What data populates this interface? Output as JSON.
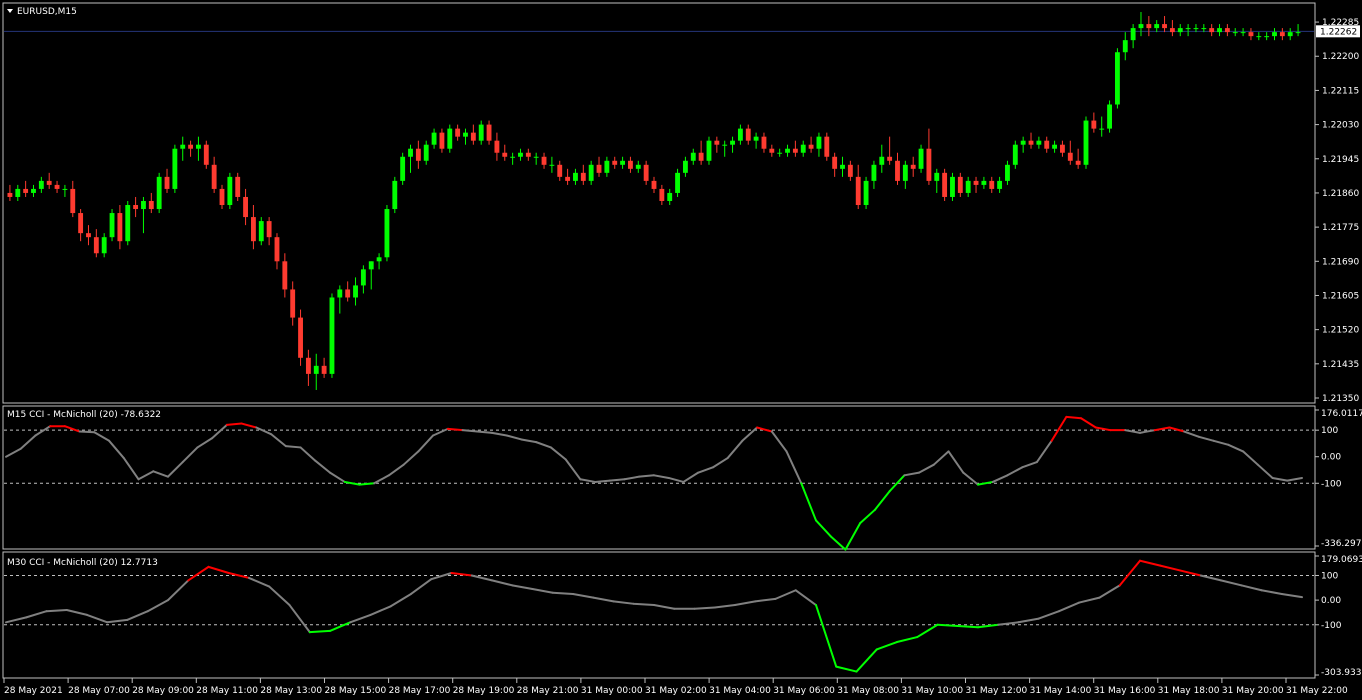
{
  "main_panel": {
    "title": "EURUSD,M15",
    "price_axis": [
      "1.22285",
      "1.22200",
      "1.22115",
      "1.22030",
      "1.21945",
      "1.21860",
      "1.21775",
      "1.21690",
      "1.21605",
      "1.21520",
      "1.21435",
      "1.21350"
    ],
    "current_price": "1.22262",
    "colors": {
      "bull": "#00ff00",
      "bear": "#ff3b30",
      "grid_line": "#24347a"
    }
  },
  "cci_m15": {
    "title": "M15 CCI - McNicholl (20) -78.6322",
    "axis": [
      "176.0117",
      "100",
      "0.00",
      "-100",
      "-336.297"
    ]
  },
  "cci_m30": {
    "title": "M30 CCI - McNicholl (20) 12.7713",
    "axis": [
      "179.0693",
      "100",
      "0.00",
      "-100",
      "-303.933"
    ]
  },
  "time_axis": [
    "28 May 2021",
    "28 May 07:00",
    "28 May 09:00",
    "28 May 11:00",
    "28 May 13:00",
    "28 May 15:00",
    "28 May 17:00",
    "28 May 19:00",
    "28 May 21:00",
    "31 May 00:00",
    "31 May 02:00",
    "31 May 04:00",
    "31 May 06:00",
    "31 May 08:00",
    "31 May 10:00",
    "31 May 12:00",
    "31 May 14:00",
    "31 May 16:00",
    "31 May 18:00",
    "31 May 20:00",
    "31 May 22:00"
  ],
  "chart_data": [
    {
      "type": "candlestick",
      "title": "EURUSD,M15",
      "ylim": [
        1.2135,
        1.2232
      ],
      "candles": [
        [
          1.2186,
          1.2188,
          1.2184,
          1.2185
        ],
        [
          1.2185,
          1.2188,
          1.2184,
          1.2187
        ],
        [
          1.2187,
          1.2189,
          1.2185,
          1.2186
        ],
        [
          1.2186,
          1.2188,
          1.2185,
          1.2187
        ],
        [
          1.2187,
          1.219,
          1.2186,
          1.2189
        ],
        [
          1.2189,
          1.2191,
          1.2187,
          1.2188
        ],
        [
          1.2188,
          1.2189,
          1.2186,
          1.2187
        ],
        [
          1.2187,
          1.2188,
          1.2185,
          1.2187
        ],
        [
          1.2187,
          1.2189,
          1.218,
          1.2181
        ],
        [
          1.2181,
          1.2182,
          1.2174,
          1.2176
        ],
        [
          1.2176,
          1.2178,
          1.2173,
          1.2175
        ],
        [
          1.2175,
          1.2177,
          1.217,
          1.2171
        ],
        [
          1.2171,
          1.2176,
          1.217,
          1.2175
        ],
        [
          1.2175,
          1.2182,
          1.2174,
          1.2181
        ],
        [
          1.2181,
          1.2183,
          1.2172,
          1.2174
        ],
        [
          1.2174,
          1.2184,
          1.2173,
          1.2183
        ],
        [
          1.2183,
          1.2185,
          1.218,
          1.2182
        ],
        [
          1.2182,
          1.2185,
          1.2176,
          1.2184
        ],
        [
          1.2184,
          1.2186,
          1.2181,
          1.2182
        ],
        [
          1.2182,
          1.2191,
          1.2181,
          1.219
        ],
        [
          1.219,
          1.2192,
          1.2186,
          1.2187
        ],
        [
          1.2187,
          1.2198,
          1.2186,
          1.2197
        ],
        [
          1.2197,
          1.22,
          1.2194,
          1.2198
        ],
        [
          1.2198,
          1.2199,
          1.2195,
          1.2197
        ],
        [
          1.2197,
          1.22,
          1.2194,
          1.2198
        ],
        [
          1.2198,
          1.2199,
          1.2192,
          1.2193
        ],
        [
          1.2193,
          1.2195,
          1.2186,
          1.2187
        ],
        [
          1.2187,
          1.2188,
          1.2182,
          1.2183
        ],
        [
          1.2183,
          1.2191,
          1.2182,
          1.219
        ],
        [
          1.219,
          1.2191,
          1.2184,
          1.2185
        ],
        [
          1.2185,
          1.2187,
          1.2178,
          1.218
        ],
        [
          1.218,
          1.2183,
          1.2172,
          1.2174
        ],
        [
          1.2174,
          1.218,
          1.2173,
          1.2179
        ],
        [
          1.2179,
          1.218,
          1.2173,
          1.2175
        ],
        [
          1.2175,
          1.2176,
          1.2167,
          1.2169
        ],
        [
          1.2169,
          1.2171,
          1.216,
          1.2162
        ],
        [
          1.2162,
          1.2164,
          1.2153,
          1.2155
        ],
        [
          1.2155,
          1.2157,
          1.2143,
          1.2145
        ],
        [
          1.2145,
          1.2147,
          1.2138,
          1.2141
        ],
        [
          1.2141,
          1.2146,
          1.2137,
          1.2143
        ],
        [
          1.2143,
          1.2145,
          1.214,
          1.2141
        ],
        [
          1.2141,
          1.2161,
          1.214,
          1.216
        ],
        [
          1.216,
          1.2163,
          1.2156,
          1.2162
        ],
        [
          1.2162,
          1.2164,
          1.2159,
          1.216
        ],
        [
          1.216,
          1.2165,
          1.2158,
          1.2163
        ],
        [
          1.2163,
          1.2168,
          1.2161,
          1.2167
        ],
        [
          1.2167,
          1.2169,
          1.2162,
          1.2169
        ],
        [
          1.2169,
          1.2171,
          1.2167,
          1.217
        ],
        [
          1.217,
          1.2183,
          1.2169,
          1.2182
        ],
        [
          1.2182,
          1.219,
          1.2181,
          1.2189
        ],
        [
          1.2189,
          1.2196,
          1.2188,
          1.2195
        ],
        [
          1.2195,
          1.2198,
          1.2191,
          1.2197
        ],
        [
          1.2197,
          1.2199,
          1.2192,
          1.2194
        ],
        [
          1.2194,
          1.2199,
          1.2193,
          1.2198
        ],
        [
          1.2198,
          1.2202,
          1.2197,
          1.2201
        ],
        [
          1.2201,
          1.2202,
          1.2196,
          1.2197
        ],
        [
          1.2197,
          1.2203,
          1.2196,
          1.2202
        ],
        [
          1.2202,
          1.2203,
          1.2199,
          1.22
        ],
        [
          1.22,
          1.2202,
          1.2198,
          1.2201
        ],
        [
          1.2201,
          1.2203,
          1.2198,
          1.2199
        ],
        [
          1.2199,
          1.2204,
          1.2198,
          1.2203
        ],
        [
          1.2203,
          1.2204,
          1.2198,
          1.2199
        ],
        [
          1.2199,
          1.2201,
          1.2194,
          1.2196
        ],
        [
          1.2196,
          1.2198,
          1.2194,
          1.2195
        ],
        [
          1.2195,
          1.2196,
          1.2193,
          1.2195
        ],
        [
          1.2195,
          1.2197,
          1.2194,
          1.2196
        ],
        [
          1.2196,
          1.2197,
          1.2194,
          1.2195
        ],
        [
          1.2195,
          1.2196,
          1.2193,
          1.2195
        ],
        [
          1.2195,
          1.2196,
          1.2192,
          1.2193
        ],
        [
          1.2193,
          1.2195,
          1.2191,
          1.2193
        ],
        [
          1.2193,
          1.2194,
          1.2189,
          1.219
        ],
        [
          1.219,
          1.2192,
          1.2188,
          1.2189
        ],
        [
          1.2189,
          1.2192,
          1.2188,
          1.2191
        ],
        [
          1.2191,
          1.2193,
          1.2188,
          1.2189
        ],
        [
          1.2189,
          1.2194,
          1.2188,
          1.2193
        ],
        [
          1.2193,
          1.2195,
          1.219,
          1.2191
        ],
        [
          1.2191,
          1.2195,
          1.219,
          1.2194
        ],
        [
          1.2194,
          1.2195,
          1.2192,
          1.2193
        ],
        [
          1.2193,
          1.2195,
          1.2192,
          1.2194
        ],
        [
          1.2194,
          1.2195,
          1.2191,
          1.2192
        ],
        [
          1.2192,
          1.2194,
          1.2191,
          1.2193
        ],
        [
          1.2193,
          1.2194,
          1.2188,
          1.2189
        ],
        [
          1.2189,
          1.219,
          1.2186,
          1.2187
        ],
        [
          1.2187,
          1.2188,
          1.2183,
          1.2184
        ],
        [
          1.2184,
          1.2187,
          1.2183,
          1.2186
        ],
        [
          1.2186,
          1.2192,
          1.2185,
          1.2191
        ],
        [
          1.2191,
          1.2195,
          1.219,
          1.2194
        ],
        [
          1.2194,
          1.2197,
          1.2193,
          1.2196
        ],
        [
          1.2196,
          1.2199,
          1.2193,
          1.2194
        ],
        [
          1.2194,
          1.22,
          1.2193,
          1.2199
        ],
        [
          1.2199,
          1.22,
          1.2196,
          1.2198
        ],
        [
          1.2198,
          1.2199,
          1.2195,
          1.2198
        ],
        [
          1.2198,
          1.22,
          1.2196,
          1.2199
        ],
        [
          1.2199,
          1.2203,
          1.2198,
          1.2202
        ],
        [
          1.2202,
          1.2203,
          1.2198,
          1.2199
        ],
        [
          1.2199,
          1.2201,
          1.2197,
          1.22
        ],
        [
          1.22,
          1.2201,
          1.2196,
          1.2197
        ],
        [
          1.2197,
          1.2198,
          1.2195,
          1.2196
        ],
        [
          1.2196,
          1.2197,
          1.2195,
          1.2196
        ],
        [
          1.2196,
          1.2198,
          1.2195,
          1.2197
        ],
        [
          1.2197,
          1.2199,
          1.2195,
          1.2196
        ],
        [
          1.2196,
          1.2199,
          1.2195,
          1.2198
        ],
        [
          1.2198,
          1.22,
          1.2196,
          1.2197
        ],
        [
          1.2197,
          1.2201,
          1.2195,
          1.22
        ],
        [
          1.22,
          1.2201,
          1.2194,
          1.2195
        ],
        [
          1.2195,
          1.2196,
          1.219,
          1.2192
        ],
        [
          1.2192,
          1.2195,
          1.219,
          1.2193
        ],
        [
          1.2193,
          1.2194,
          1.2189,
          1.219
        ],
        [
          1.219,
          1.2193,
          1.2182,
          1.2183
        ],
        [
          1.2183,
          1.219,
          1.2182,
          1.2189
        ],
        [
          1.2189,
          1.2194,
          1.2187,
          1.2193
        ],
        [
          1.2193,
          1.2198,
          1.2191,
          1.2195
        ],
        [
          1.2195,
          1.22,
          1.2193,
          1.2194
        ],
        [
          1.2194,
          1.2196,
          1.2188,
          1.2189
        ],
        [
          1.2189,
          1.2194,
          1.2187,
          1.2193
        ],
        [
          1.2193,
          1.2195,
          1.219,
          1.2192
        ],
        [
          1.2192,
          1.2198,
          1.2191,
          1.2197
        ],
        [
          1.2197,
          1.2202,
          1.2188,
          1.2189
        ],
        [
          1.2189,
          1.2192,
          1.2186,
          1.2191
        ],
        [
          1.2191,
          1.2192,
          1.2184,
          1.2185
        ],
        [
          1.2185,
          1.2191,
          1.2184,
          1.219
        ],
        [
          1.219,
          1.2191,
          1.2185,
          1.2186
        ],
        [
          1.2186,
          1.219,
          1.2185,
          1.2189
        ],
        [
          1.2189,
          1.219,
          1.2186,
          1.2188
        ],
        [
          1.2188,
          1.219,
          1.2187,
          1.2189
        ],
        [
          1.2189,
          1.219,
          1.2186,
          1.2187
        ],
        [
          1.2187,
          1.219,
          1.2186,
          1.2189
        ],
        [
          1.2189,
          1.2194,
          1.2188,
          1.2193
        ],
        [
          1.2193,
          1.2199,
          1.2192,
          1.2198
        ],
        [
          1.2198,
          1.22,
          1.2196,
          1.2199
        ],
        [
          1.2199,
          1.2201,
          1.2197,
          1.2198
        ],
        [
          1.2198,
          1.22,
          1.2197,
          1.2199
        ],
        [
          1.2199,
          1.22,
          1.2196,
          1.2197
        ],
        [
          1.2197,
          1.2199,
          1.2196,
          1.2198
        ],
        [
          1.2198,
          1.2199,
          1.2195,
          1.2196
        ],
        [
          1.2196,
          1.2199,
          1.2193,
          1.2194
        ],
        [
          1.2194,
          1.2197,
          1.2192,
          1.2193
        ],
        [
          1.2193,
          1.2205,
          1.2192,
          1.2204
        ],
        [
          1.2204,
          1.2206,
          1.2201,
          1.2202
        ],
        [
          1.2202,
          1.2205,
          1.22,
          1.2202
        ],
        [
          1.2202,
          1.2209,
          1.2201,
          1.2208
        ],
        [
          1.2208,
          1.2222,
          1.2207,
          1.2221
        ],
        [
          1.2221,
          1.2226,
          1.2219,
          1.2224
        ],
        [
          1.2224,
          1.2228,
          1.2222,
          1.2227
        ],
        [
          1.2227,
          1.2231,
          1.2225,
          1.2228
        ],
        [
          1.2228,
          1.223,
          1.2225,
          1.2227
        ],
        [
          1.2227,
          1.2229,
          1.2226,
          1.2228
        ],
        [
          1.2228,
          1.223,
          1.2226,
          1.2227
        ],
        [
          1.2227,
          1.2229,
          1.2225,
          1.2226
        ],
        [
          1.2226,
          1.2228,
          1.2225,
          1.2227
        ],
        [
          1.2227,
          1.2228,
          1.2225,
          1.2227
        ],
        [
          1.2227,
          1.2228,
          1.2226,
          1.2227
        ],
        [
          1.2227,
          1.2228,
          1.2226,
          1.2227
        ],
        [
          1.2227,
          1.2228,
          1.2225,
          1.2226
        ],
        [
          1.2226,
          1.2228,
          1.2225,
          1.2227
        ],
        [
          1.2227,
          1.2228,
          1.2225,
          1.2226
        ],
        [
          1.2226,
          1.2227,
          1.2225,
          1.2226
        ],
        [
          1.2226,
          1.2227,
          1.2225,
          1.2226
        ],
        [
          1.2226,
          1.2227,
          1.2224,
          1.2225
        ],
        [
          1.2225,
          1.2226,
          1.2224,
          1.2225
        ],
        [
          1.2225,
          1.2226,
          1.2224,
          1.2225
        ],
        [
          1.2225,
          1.2227,
          1.2224,
          1.2226
        ],
        [
          1.2226,
          1.2227,
          1.2224,
          1.2225
        ],
        [
          1.2225,
          1.2227,
          1.2224,
          1.2226
        ],
        [
          1.2226,
          1.2228,
          1.2225,
          1.2226
        ]
      ]
    },
    {
      "type": "line",
      "title": "M15 CCI - McNicholl (20) -78.6322",
      "ylim": [
        -336.297,
        176.0117
      ],
      "levels": [
        100,
        0,
        -100
      ],
      "values": [
        0,
        30,
        80,
        115,
        115,
        95,
        92,
        60,
        -5,
        -85,
        -55,
        -75,
        -20,
        35,
        70,
        120,
        125,
        110,
        85,
        40,
        35,
        -15,
        -60,
        -95,
        -105,
        -100,
        -70,
        -30,
        20,
        80,
        105,
        100,
        95,
        90,
        80,
        65,
        55,
        35,
        -10,
        -85,
        -95,
        -90,
        -85,
        -75,
        -70,
        -80,
        -95,
        -60,
        -40,
        -5,
        60,
        110,
        95,
        20,
        -100,
        -240,
        -300,
        -350,
        -250,
        -200,
        -130,
        -70,
        -60,
        -30,
        20,
        -60,
        -105,
        -95,
        -70,
        -40,
        -20,
        60,
        150,
        145,
        110,
        100,
        100,
        90,
        100,
        110,
        95,
        75,
        60,
        45,
        20,
        -30,
        -80,
        -90,
        -80
      ],
      "segments_over_100": "#ff0000",
      "segments_under_minus_100": "#00ff00",
      "neutral": "#808080"
    },
    {
      "type": "line",
      "title": "M30 CCI - McNicholl (20) 12.7713",
      "ylim": [
        -303.933,
        179.0693
      ],
      "levels": [
        100,
        0,
        -100
      ],
      "values": [
        -90,
        -70,
        -45,
        -40,
        -60,
        -90,
        -80,
        -45,
        0,
        80,
        135,
        110,
        90,
        55,
        -20,
        -130,
        -125,
        -90,
        -60,
        -25,
        25,
        85,
        110,
        100,
        80,
        60,
        45,
        30,
        25,
        10,
        -5,
        -15,
        -20,
        -35,
        -35,
        -30,
        -20,
        -5,
        5,
        40,
        -20,
        -270,
        -290,
        -200,
        -170,
        -150,
        -100,
        -105,
        -110,
        -100,
        -90,
        -75,
        -45,
        -10,
        10,
        60,
        160,
        140,
        120,
        100,
        80,
        60,
        40,
        25,
        12
      ],
      "segments_over_100": "#ff0000",
      "segments_under_minus_100": "#00ff00",
      "neutral": "#808080"
    }
  ]
}
